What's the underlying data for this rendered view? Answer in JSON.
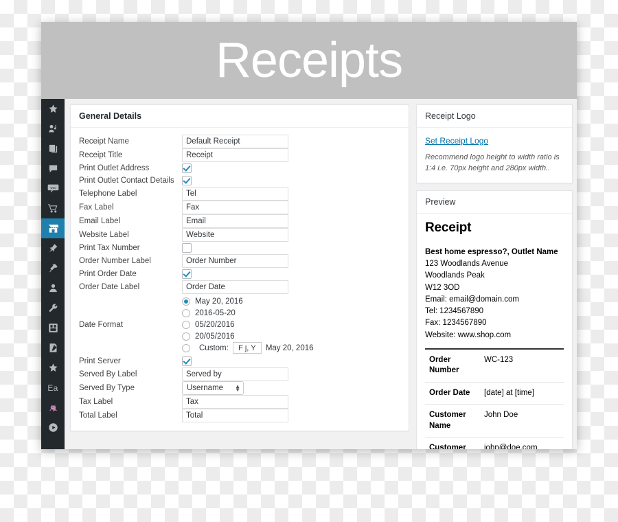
{
  "banner": {
    "title": "Receipts"
  },
  "sidebar": {
    "items": [
      {
        "name": "star-icon",
        "label": "Favorites"
      },
      {
        "name": "media-icon",
        "label": "Media"
      },
      {
        "name": "pages-icon",
        "label": "Pages"
      },
      {
        "name": "comments-icon",
        "label": "Comments"
      },
      {
        "name": "woocommerce-icon",
        "label": "WooCommerce"
      },
      {
        "name": "cart-icon",
        "label": "Products"
      },
      {
        "name": "shop-icon",
        "label": "Point of Sale",
        "active": true
      },
      {
        "name": "pin-icon",
        "label": "Appearance"
      },
      {
        "name": "plugin-icon",
        "label": "Plugins"
      },
      {
        "name": "user-icon",
        "label": "Users"
      },
      {
        "name": "wrench-icon",
        "label": "Tools"
      },
      {
        "name": "settings-grid-icon",
        "label": "Settings"
      },
      {
        "name": "forms-icon",
        "label": "Forms"
      },
      {
        "name": "star-alt-icon",
        "label": "Extensions"
      },
      {
        "name": "ea-text-icon",
        "label": "Ea"
      },
      {
        "name": "octopus-icon",
        "label": "Octopus"
      },
      {
        "name": "play-circle-icon",
        "label": "Media Player"
      }
    ]
  },
  "general": {
    "heading": "General Details",
    "fields": {
      "receipt_name": {
        "label": "Receipt Name",
        "value": "Default Receipt"
      },
      "receipt_title": {
        "label": "Receipt Title",
        "value": "Receipt"
      },
      "print_outlet_address": {
        "label": "Print Outlet Address",
        "checked": true
      },
      "print_outlet_contact": {
        "label": "Print Outlet Contact Details",
        "checked": true
      },
      "telephone_label": {
        "label": "Telephone Label",
        "value": "Tel"
      },
      "fax_label": {
        "label": "Fax Label",
        "value": "Fax"
      },
      "email_label": {
        "label": "Email Label",
        "value": "Email"
      },
      "website_label": {
        "label": "Website Label",
        "value": "Website"
      },
      "print_tax_number": {
        "label": "Print Tax Number",
        "checked": false
      },
      "order_number_label": {
        "label": "Order Number Label",
        "value": "Order Number"
      },
      "print_order_date": {
        "label": "Print Order Date",
        "checked": true
      },
      "order_date_label": {
        "label": "Order Date Label",
        "value": "Order Date"
      },
      "date_format": {
        "label": "Date Format",
        "options": [
          {
            "text": "May 20, 2016",
            "selected": true
          },
          {
            "text": "2016-05-20",
            "selected": false
          },
          {
            "text": "05/20/2016",
            "selected": false
          },
          {
            "text": "20/05/2016",
            "selected": false
          }
        ],
        "custom": {
          "label": "Custom:",
          "value": "F j, Y",
          "preview": "May 20, 2016",
          "selected": false
        }
      },
      "print_server": {
        "label": "Print Server",
        "checked": true
      },
      "served_by_label": {
        "label": "Served By Label",
        "value": "Served by"
      },
      "served_by_type": {
        "label": "Served By Type",
        "value": "Username"
      },
      "tax_label": {
        "label": "Tax Label",
        "value": "Tax"
      },
      "total_label": {
        "label": "Total Label",
        "value": "Total"
      }
    }
  },
  "receipt_logo": {
    "heading": "Receipt Logo",
    "link": "Set Receipt Logo",
    "note": "Recommend logo height to width ratio is 1:4 i.e. 70px height and 280px width.."
  },
  "preview": {
    "heading": "Preview",
    "title": "Receipt",
    "store_name": "Best home espresso?, Outlet Name",
    "address": [
      "123 Woodlands Avenue",
      "Woodlands Peak",
      "W12 3OD"
    ],
    "contact": [
      "Email: email@domain.com",
      "Tel: 1234567890",
      "Fax: 1234567890",
      "Website: www.shop.com"
    ],
    "rows": [
      {
        "key": "Order Number",
        "value": "WC-123"
      },
      {
        "key": "Order Date",
        "value": "[date] at [time]"
      },
      {
        "key": "Customer Name",
        "value": "John Doe"
      },
      {
        "key": "Customer Email",
        "value": "john@doe.com"
      }
    ]
  },
  "colors": {
    "accent": "#0073aa",
    "sidebar_bg": "#23282d",
    "banner_bg": "#c0c0c0",
    "checkbox_check": "#1e8cbe",
    "content_bg": "#f1f1f1"
  }
}
